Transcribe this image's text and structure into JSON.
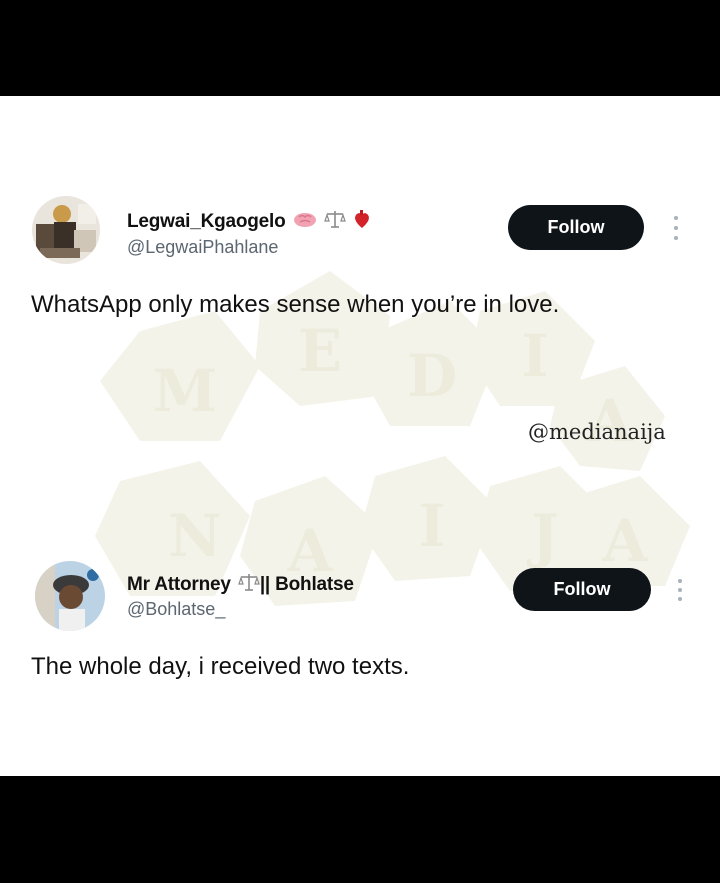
{
  "watermark": {
    "letters": [
      "M",
      "E",
      "D",
      "I",
      "A",
      "N",
      "A",
      "I",
      "J",
      "A"
    ],
    "tile_color": "#f3f2e8",
    "letter_color": "#e8e6d2"
  },
  "tweet1": {
    "display_name": "Legwai_Kgaogelo",
    "name_emojis": [
      "brain-icon",
      "scales-icon",
      "heart-organ-icon"
    ],
    "handle": "@LegwaiPhahlane",
    "follow_label": "Follow",
    "text": "WhatsApp only makes sense when you’re in love."
  },
  "credit": "@medianaija",
  "tweet2": {
    "display_name_before": "Mr Attorney",
    "name_emoji": "scales-icon",
    "display_name_after": "|| Bohlatse",
    "handle": "@Bohlatse_",
    "follow_label": "Follow",
    "text": "The whole day, i received two texts."
  },
  "colors": {
    "button_bg": "#0f1419",
    "handle_gray": "#5b6670",
    "background": "#000000",
    "card": "#ffffff"
  }
}
